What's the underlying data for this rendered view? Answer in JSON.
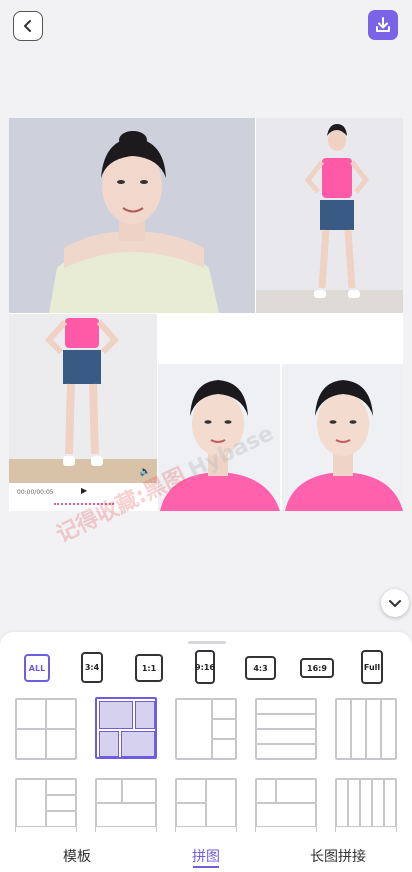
{
  "video": {
    "time": "00:00/00:05"
  },
  "watermark": {
    "cn": "记得收藏:黑图",
    "en": "Hybase"
  },
  "ratios": [
    {
      "label": "ALL",
      "active": true
    },
    {
      "label": "3:4"
    },
    {
      "label": "1:1"
    },
    {
      "label": "9:16"
    },
    {
      "label": "4:3"
    },
    {
      "label": "16:9"
    },
    {
      "label": "Full"
    }
  ],
  "tabs": [
    {
      "label": "模板"
    },
    {
      "label": "拼图",
      "active": true
    },
    {
      "label": "长图拼接"
    }
  ],
  "colors": {
    "accent": "#6f5de0",
    "download": "#7a63e6"
  },
  "icons": [
    "back-icon",
    "download-icon",
    "chevron-down-icon",
    "play-icon",
    "speaker-icon"
  ]
}
